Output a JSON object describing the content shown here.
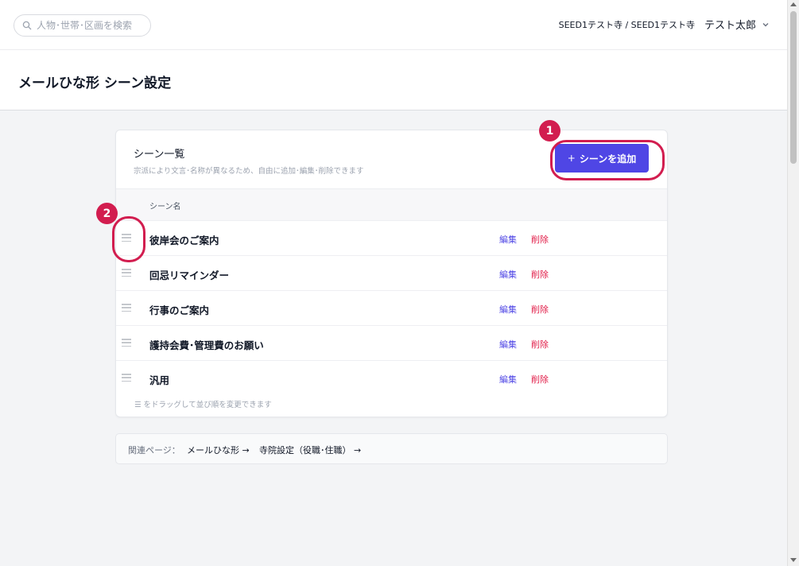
{
  "header": {
    "search_placeholder": "人物･世帯･区画を検索",
    "tenant": "SEED1テスト寺 / SEED1テスト寺",
    "user_name": "テスト太郎"
  },
  "page": {
    "title": "メールひな形 シーン設定"
  },
  "scene_list": {
    "title": "シーン一覧",
    "subtitle": "宗派により文言･名称が異なるため、自由に追加･編集･削除できます",
    "add_button_plus": "+",
    "add_button_label": "シーンを追加",
    "column_header": "シーン名",
    "rows": [
      {
        "name": "彼岸会のご案内",
        "edit_label": "編集",
        "delete_label": "削除"
      },
      {
        "name": "回忌リマインダー",
        "edit_label": "編集",
        "delete_label": "削除"
      },
      {
        "name": "行事のご案内",
        "edit_label": "編集",
        "delete_label": "削除"
      },
      {
        "name": "護持会費･管理費のお願い",
        "edit_label": "編集",
        "delete_label": "削除"
      },
      {
        "name": "汎用",
        "edit_label": "編集",
        "delete_label": "削除"
      }
    ],
    "drag_hint": "☰ をドラッグして並び順を変更できます"
  },
  "related": {
    "label": "関連ページ：",
    "links": [
      "メールひな形 →",
      "寺院設定（役職･住職） →"
    ]
  },
  "annotations": {
    "first": "1",
    "second": "2"
  },
  "colors": {
    "accent": "#4f46e5",
    "danger": "#e11d48",
    "annotation": "#d21d4f"
  },
  "icons": {
    "search": "search-icon",
    "user_menu": "chevron-down-icon",
    "row_handle": "drag-handle-icon"
  }
}
